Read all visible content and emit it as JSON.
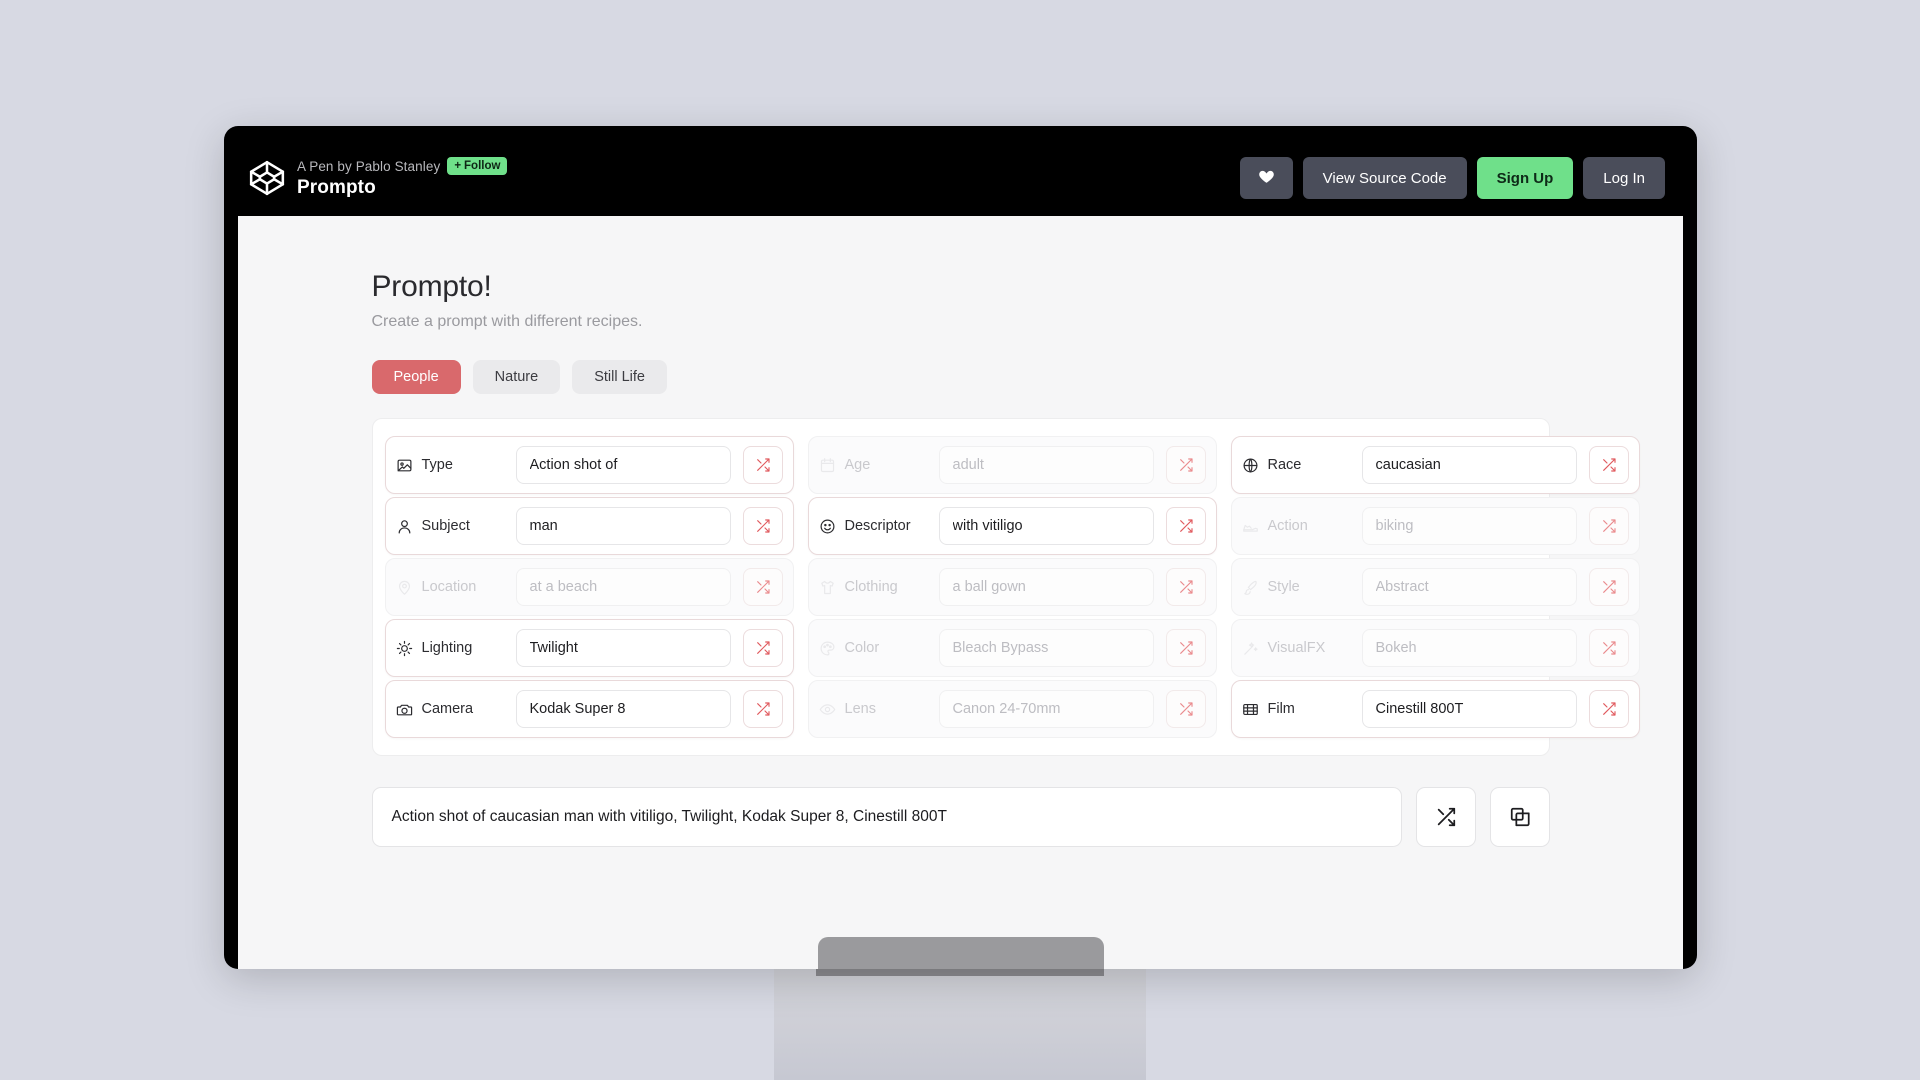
{
  "codepen_bar": {
    "logo_icon": "codepen-logo-icon",
    "byline": "A Pen by Pablo Stanley",
    "follow_label": "Follow",
    "follow_icon": "plus-icon",
    "pen_title": "Prompto",
    "heart_icon": "heart-icon",
    "view_source_label": "View Source Code",
    "sign_up_label": "Sign Up",
    "log_in_label": "Log In",
    "follow_color": "#6fe08a",
    "sign_up_color": "#6fe08a"
  },
  "app": {
    "title": "Prompto!",
    "subtitle": "Create a prompt with different recipes.",
    "accent_color": "#d9696c",
    "tabs": [
      {
        "label": "People",
        "active": true
      },
      {
        "label": "Nature",
        "active": false
      },
      {
        "label": "Still Life",
        "active": false
      }
    ],
    "shuffle_icon": "shuffle-icon",
    "rows": [
      {
        "label": "Type",
        "icon": "image-icon",
        "value": "Action shot of",
        "placeholder": "",
        "active": true
      },
      {
        "label": "Age",
        "icon": "calendar-icon",
        "value": "",
        "placeholder": "adult",
        "active": false
      },
      {
        "label": "Race",
        "icon": "globe-icon",
        "value": "caucasian",
        "placeholder": "",
        "active": true
      },
      {
        "label": "Subject",
        "icon": "person-icon",
        "value": "man",
        "placeholder": "",
        "active": true
      },
      {
        "label": "Descriptor",
        "icon": "smiley-icon",
        "value": "with vitiligo",
        "placeholder": "",
        "active": true
      },
      {
        "label": "Action",
        "icon": "shoe-icon",
        "value": "",
        "placeholder": "biking",
        "active": false
      },
      {
        "label": "Location",
        "icon": "map-pin-icon",
        "value": "",
        "placeholder": "at a beach",
        "active": false
      },
      {
        "label": "Clothing",
        "icon": "shirt-icon",
        "value": "",
        "placeholder": "a ball gown",
        "active": false
      },
      {
        "label": "Style",
        "icon": "brush-icon",
        "value": "",
        "placeholder": "Abstract",
        "active": false
      },
      {
        "label": "Lighting",
        "icon": "sun-icon",
        "value": "Twilight",
        "placeholder": "",
        "active": true
      },
      {
        "label": "Color",
        "icon": "palette-icon",
        "value": "",
        "placeholder": "Bleach Bypass",
        "active": false
      },
      {
        "label": "VisualFX",
        "icon": "magic-wand-icon",
        "value": "",
        "placeholder": "Bokeh",
        "active": false
      },
      {
        "label": "Camera",
        "icon": "camera-icon",
        "value": "Kodak Super 8",
        "placeholder": "",
        "active": true
      },
      {
        "label": "Lens",
        "icon": "eye-icon",
        "value": "",
        "placeholder": "Canon 24-70mm",
        "active": false
      },
      {
        "label": "Film",
        "icon": "film-icon",
        "value": "Cinestill 800T",
        "placeholder": "",
        "active": true
      }
    ],
    "output": {
      "prompt": "Action shot of caucasian man with vitiligo, Twilight, Kodak Super 8, Cinestill 800T",
      "shuffle_icon": "shuffle-icon",
      "copy_icon": "copy-icon"
    }
  }
}
